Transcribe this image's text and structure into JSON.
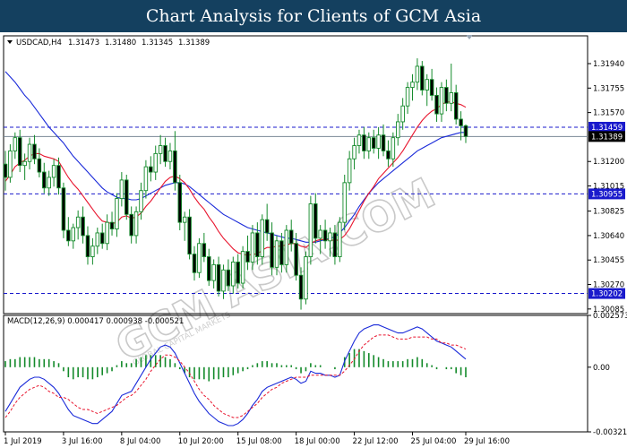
{
  "banner": {
    "title": "Chart Analysis for Clients of GCM Asia"
  },
  "watermark": {
    "text": "GCM ASIA.COM",
    "subtext": "GLOBAL CAPITAL MARKETS"
  },
  "icons": {
    "collapse": "triangle-down-icon",
    "scroll_marker": "triangle-down-icon"
  },
  "chart_data": [
    {
      "type": "candlestick",
      "symbol": "USDCAD,H4",
      "ohlc_header": {
        "open": "1.31473",
        "high": "1.31480",
        "low": "1.31345",
        "close": "1.31389"
      },
      "ylim": [
        1.3005,
        1.3215
      ],
      "yticks": [
        "1.31940",
        "1.31755",
        "1.31570",
        "1.31200",
        "1.31015",
        "1.30825",
        "1.30640",
        "1.30455",
        "1.30270",
        "1.30085"
      ],
      "xticks": [
        "1 Jul 2019",
        "3 Jul 16:00",
        "8 Jul 04:00",
        "10 Jul 20:00",
        "15 Jul 08:00",
        "18 Jul 00:00",
        "22 Jul 12:00",
        "25 Jul 04:00",
        "29 Jul 16:00"
      ],
      "levels": [
        {
          "value": 1.31459,
          "label": "1.31459",
          "color": "#1a1acc"
        },
        {
          "value": 1.31389,
          "label": "1.31389",
          "color": "#000000"
        },
        {
          "value": 1.30955,
          "label": "1.30955",
          "color": "#1a1acc"
        },
        {
          "value": 1.30202,
          "label": "1.30202",
          "color": "#1a1acc"
        }
      ],
      "colors": {
        "candle": "#138a2a",
        "fast_ma": "#e8142d",
        "slow_ma": "#1a2ad9",
        "level": "#1a1acc"
      },
      "candles": [
        [
          1.3118,
          1.3128,
          1.3098,
          1.3108
        ],
        [
          1.3108,
          1.3133,
          1.3104,
          1.3128
        ],
        [
          1.3128,
          1.3142,
          1.3122,
          1.3138
        ],
        [
          1.3138,
          1.3144,
          1.3112,
          1.3117
        ],
        [
          1.3117,
          1.3126,
          1.3106,
          1.312
        ],
        [
          1.312,
          1.3138,
          1.3114,
          1.3133
        ],
        [
          1.3133,
          1.314,
          1.3118,
          1.3122
        ],
        [
          1.3122,
          1.313,
          1.3108,
          1.3112
        ],
        [
          1.3112,
          1.3119,
          1.3096,
          1.31
        ],
        [
          1.31,
          1.3113,
          1.3094,
          1.3108
        ],
        [
          1.3108,
          1.3122,
          1.3101,
          1.3117
        ],
        [
          1.3117,
          1.3123,
          1.3095,
          1.31
        ],
        [
          1.31,
          1.3104,
          1.3062,
          1.3068
        ],
        [
          1.3068,
          1.3078,
          1.3056,
          1.306
        ],
        [
          1.306,
          1.3073,
          1.3054,
          1.307
        ],
        [
          1.307,
          1.3083,
          1.3061,
          1.3078
        ],
        [
          1.3078,
          1.3086,
          1.3058,
          1.3064
        ],
        [
          1.3064,
          1.3071,
          1.3042,
          1.3048
        ],
        [
          1.3048,
          1.3062,
          1.3042,
          1.3056
        ],
        [
          1.3056,
          1.307,
          1.305,
          1.3066
        ],
        [
          1.3066,
          1.3073,
          1.3054,
          1.3058
        ],
        [
          1.3058,
          1.308,
          1.3053,
          1.3074
        ],
        [
          1.3074,
          1.3082,
          1.3064,
          1.3069
        ],
        [
          1.3069,
          1.3096,
          1.3063,
          1.3092
        ],
        [
          1.3092,
          1.3112,
          1.3086,
          1.3106
        ],
        [
          1.3106,
          1.311,
          1.3076,
          1.308
        ],
        [
          1.308,
          1.3086,
          1.3058,
          1.3064
        ],
        [
          1.3064,
          1.3086,
          1.3058,
          1.3082
        ],
        [
          1.3082,
          1.3104,
          1.3076,
          1.3098
        ],
        [
          1.3098,
          1.3121,
          1.3092,
          1.3116
        ],
        [
          1.3116,
          1.3124,
          1.3105,
          1.3112
        ],
        [
          1.3112,
          1.3132,
          1.3106,
          1.3126
        ],
        [
          1.3126,
          1.314,
          1.3118,
          1.3132
        ],
        [
          1.3132,
          1.3138,
          1.3116,
          1.312
        ],
        [
          1.312,
          1.3134,
          1.3114,
          1.3128
        ],
        [
          1.3128,
          1.3143,
          1.3098,
          1.3104
        ],
        [
          1.3104,
          1.311,
          1.3068,
          1.3074
        ],
        [
          1.3074,
          1.3082,
          1.306,
          1.3078
        ],
        [
          1.3078,
          1.3084,
          1.3046,
          1.305
        ],
        [
          1.305,
          1.3056,
          1.303,
          1.3036
        ],
        [
          1.3036,
          1.3062,
          1.3032,
          1.3058
        ],
        [
          1.3058,
          1.3066,
          1.3044,
          1.3048
        ],
        [
          1.3048,
          1.3054,
          1.3026,
          1.303
        ],
        [
          1.303,
          1.3046,
          1.3024,
          1.3042
        ],
        [
          1.3042,
          1.3048,
          1.3018,
          1.3022
        ],
        [
          1.3022,
          1.3042,
          1.3016,
          1.3038
        ],
        [
          1.3038,
          1.3046,
          1.3022,
          1.3026
        ],
        [
          1.3026,
          1.3048,
          1.302,
          1.3044
        ],
        [
          1.3044,
          1.305,
          1.3024,
          1.3028
        ],
        [
          1.3028,
          1.3056,
          1.3024,
          1.3052
        ],
        [
          1.3052,
          1.3064,
          1.3038,
          1.3044
        ],
        [
          1.3044,
          1.3072,
          1.3038,
          1.3066
        ],
        [
          1.3066,
          1.3074,
          1.3042,
          1.3048
        ],
        [
          1.3048,
          1.308,
          1.3042,
          1.3076
        ],
        [
          1.3076,
          1.3088,
          1.306,
          1.3066
        ],
        [
          1.3066,
          1.3074,
          1.3034,
          1.304
        ],
        [
          1.304,
          1.3064,
          1.3034,
          1.306
        ],
        [
          1.306,
          1.3066,
          1.3036,
          1.3042
        ],
        [
          1.3042,
          1.3072,
          1.3036,
          1.3068
        ],
        [
          1.3068,
          1.3076,
          1.3052,
          1.3058
        ],
        [
          1.3058,
          1.3066,
          1.303,
          1.3034
        ],
        [
          1.3034,
          1.304,
          1.3008,
          1.3016
        ],
        [
          1.3016,
          1.3052,
          1.3012,
          1.3048
        ],
        [
          1.3048,
          1.3094,
          1.3042,
          1.3088
        ],
        [
          1.3088,
          1.3096,
          1.3058,
          1.3062
        ],
        [
          1.3062,
          1.3072,
          1.305,
          1.3068
        ],
        [
          1.3068,
          1.3076,
          1.3054,
          1.306
        ],
        [
          1.306,
          1.307,
          1.3048,
          1.3066
        ],
        [
          1.3066,
          1.3072,
          1.3042,
          1.3048
        ],
        [
          1.3048,
          1.3078,
          1.3044,
          1.3074
        ],
        [
          1.3074,
          1.311,
          1.3068,
          1.3104
        ],
        [
          1.3104,
          1.3128,
          1.3098,
          1.3122
        ],
        [
          1.3122,
          1.3138,
          1.3114,
          1.3132
        ],
        [
          1.3132,
          1.3144,
          1.3126,
          1.314
        ],
        [
          1.314,
          1.3146,
          1.3122,
          1.3128
        ],
        [
          1.3128,
          1.3142,
          1.3122,
          1.3138
        ],
        [
          1.3138,
          1.3144,
          1.3126,
          1.313
        ],
        [
          1.313,
          1.3146,
          1.3122,
          1.314
        ],
        [
          1.314,
          1.3148,
          1.3124,
          1.3128
        ],
        [
          1.3128,
          1.3136,
          1.3116,
          1.3122
        ],
        [
          1.3122,
          1.3142,
          1.3116,
          1.3138
        ],
        [
          1.3138,
          1.3156,
          1.3132,
          1.315
        ],
        [
          1.315,
          1.3168,
          1.3144,
          1.3162
        ],
        [
          1.3162,
          1.318,
          1.3156,
          1.3176
        ],
        [
          1.3176,
          1.3186,
          1.3166,
          1.318
        ],
        [
          1.318,
          1.3198,
          1.3174,
          1.3192
        ],
        [
          1.3192,
          1.3196,
          1.317,
          1.3174
        ],
        [
          1.3174,
          1.3186,
          1.3162,
          1.3182
        ],
        [
          1.3182,
          1.319,
          1.3166,
          1.317
        ],
        [
          1.317,
          1.3176,
          1.315,
          1.3156
        ],
        [
          1.3156,
          1.318,
          1.315,
          1.3176
        ],
        [
          1.3176,
          1.3182,
          1.3158,
          1.3164
        ],
        [
          1.3164,
          1.3194,
          1.3158,
          1.3172
        ],
        [
          1.3172,
          1.3178,
          1.3148,
          1.3152
        ],
        [
          1.3152,
          1.3158,
          1.3136,
          1.3147
        ],
        [
          1.3147,
          1.3148,
          1.3134,
          1.3139
        ]
      ],
      "ma_fast": [
        1.3105,
        1.311,
        1.3116,
        1.3119,
        1.3121,
        1.3124,
        1.3126,
        1.3126,
        1.3124,
        1.3123,
        1.3122,
        1.312,
        1.3114,
        1.3108,
        1.3103,
        1.3099,
        1.3094,
        1.3089,
        1.3084,
        1.3079,
        1.3075,
        1.3074,
        1.3073,
        1.3074,
        1.3078,
        1.3079,
        1.3077,
        1.3078,
        1.3081,
        1.3086,
        1.309,
        1.3095,
        1.31,
        1.3105,
        1.3108,
        1.3109,
        1.3107,
        1.3104,
        1.3099,
        1.3093,
        1.3088,
        1.3084,
        1.3078,
        1.3073,
        1.3067,
        1.3062,
        1.3058,
        1.3054,
        1.3051,
        1.305,
        1.3049,
        1.305,
        1.305,
        1.3053,
        1.3055,
        1.3055,
        1.3056,
        1.3056,
        1.3057,
        1.3058,
        1.3058,
        1.3056,
        1.3055,
        1.3058,
        1.306,
        1.3061,
        1.3061,
        1.3061,
        1.306,
        1.3061,
        1.3064,
        1.3069,
        1.3076,
        1.3083,
        1.309,
        1.3096,
        1.3101,
        1.3107,
        1.3111,
        1.3115,
        1.3119,
        1.3123,
        1.3128,
        1.3134,
        1.314,
        1.3146,
        1.3151,
        1.3155,
        1.3158,
        1.316,
        1.3163,
        1.3165,
        1.3165,
        1.3164,
        1.3163,
        1.3161
      ],
      "ma_slow": [
        1.3188,
        1.3184,
        1.318,
        1.3175,
        1.317,
        1.3166,
        1.3161,
        1.3156,
        1.3151,
        1.3146,
        1.3142,
        1.3138,
        1.3134,
        1.3129,
        1.3124,
        1.312,
        1.3116,
        1.3112,
        1.3108,
        1.3104,
        1.31,
        1.3097,
        1.3095,
        1.3093,
        1.3092,
        1.3092,
        1.3091,
        1.3091,
        1.3092,
        1.3094,
        1.3096,
        1.3098,
        1.31,
        1.3102,
        1.3103,
        1.3104,
        1.3104,
        1.3103,
        1.3101,
        1.3098,
        1.3095,
        1.3092,
        1.3089,
        1.3086,
        1.3083,
        1.308,
        1.3078,
        1.3076,
        1.3074,
        1.3072,
        1.307,
        1.3069,
        1.3068,
        1.3067,
        1.3066,
        1.3065,
        1.3064,
        1.3063,
        1.3062,
        1.3062,
        1.3061,
        1.306,
        1.3059,
        1.3059,
        1.3059,
        1.306,
        1.3061,
        1.3062,
        1.3063,
        1.3066,
        1.307,
        1.3075,
        1.308,
        1.3086,
        1.3091,
        1.3096,
        1.31,
        1.3104,
        1.3107,
        1.311,
        1.3113,
        1.3116,
        1.3119,
        1.3122,
        1.3125,
        1.3128,
        1.313,
        1.3132,
        1.3134,
        1.3136,
        1.3138,
        1.3139,
        1.314,
        1.3141,
        1.3142,
        1.3142
      ]
    },
    {
      "type": "macd",
      "label": "MACD(12,26,9) 0.000417 0.000938 -0.000521",
      "yticks": [
        "0.002573",
        "0.00",
        "-0.003213"
      ],
      "ylim": [
        -0.003213,
        0.002573
      ],
      "colors": {
        "hist": "#138a2a",
        "macd": "#1a2ad9",
        "signal": "#e8142d"
      },
      "hist": [
        0.0003,
        0.0004,
        0.0004,
        0.0005,
        0.0005,
        0.0005,
        0.0005,
        0.0004,
        0.0004,
        0.0004,
        0.0003,
        0.0002,
        -0.0002,
        -0.0005,
        -0.0006,
        -0.0005,
        -0.0005,
        -0.0006,
        -0.0006,
        -0.0005,
        -0.0004,
        -0.0003,
        -0.0002,
        0.0001,
        0.0003,
        0.0002,
        0.0002,
        0.0004,
        0.0005,
        0.0006,
        0.0006,
        0.0006,
        0.0006,
        0.0005,
        0.0004,
        0.0002,
        -0.0001,
        -0.0003,
        -0.0005,
        -0.0006,
        -0.0006,
        -0.0006,
        -0.0007,
        -0.0006,
        -0.0006,
        -0.0005,
        -0.0005,
        -0.0004,
        -0.0003,
        -0.0002,
        -0.0001,
        0.0001,
        0.0002,
        0.0003,
        0.0003,
        0.0002,
        0.0002,
        0.0001,
        0.0001,
        0.0001,
        -0.0001,
        -0.0003,
        -0.0002,
        0.0002,
        0.0001,
        0.0001,
        0.0,
        0.0,
        -0.0001,
        0.0,
        0.0005,
        0.0007,
        0.0009,
        0.0009,
        0.0008,
        0.0007,
        0.0006,
        0.0005,
        0.0004,
        0.0003,
        0.0003,
        0.0003,
        0.0003,
        0.0004,
        0.0004,
        0.0005,
        0.0004,
        0.0002,
        0.0001,
        -0.0001,
        0.0,
        -0.0001,
        -0.0001,
        -0.0003,
        -0.0004,
        -0.0005
      ],
      "macd": [
        -0.0022,
        -0.0018,
        -0.0014,
        -0.001,
        -0.0008,
        -0.0006,
        -0.0005,
        -0.0005,
        -0.0006,
        -0.0008,
        -0.001,
        -0.0013,
        -0.0017,
        -0.0021,
        -0.0024,
        -0.0025,
        -0.0026,
        -0.0027,
        -0.0028,
        -0.0028,
        -0.0026,
        -0.0024,
        -0.0022,
        -0.0018,
        -0.0014,
        -0.0013,
        -0.0012,
        -0.0008,
        -0.0004,
        0.0,
        0.0004,
        0.0007,
        0.001,
        0.0011,
        0.001,
        0.0007,
        0.0002,
        -0.0003,
        -0.0008,
        -0.0013,
        -0.0017,
        -0.002,
        -0.0023,
        -0.0025,
        -0.0027,
        -0.0028,
        -0.0029,
        -0.0029,
        -0.0028,
        -0.0026,
        -0.0023,
        -0.0019,
        -0.0016,
        -0.0012,
        -0.001,
        -0.0009,
        -0.0008,
        -0.0007,
        -0.0006,
        -0.0005,
        -0.0006,
        -0.0008,
        -0.0007,
        -0.0002,
        -0.0003,
        -0.0003,
        -0.0004,
        -0.0004,
        -0.0005,
        -0.0004,
        0.0003,
        0.0008,
        0.0013,
        0.0017,
        0.0019,
        0.002,
        0.0021,
        0.0021,
        0.002,
        0.0019,
        0.0018,
        0.0017,
        0.0017,
        0.0018,
        0.0019,
        0.002,
        0.0019,
        0.0017,
        0.0015,
        0.0013,
        0.0012,
        0.0011,
        0.001,
        0.0008,
        0.0006,
        0.0004
      ],
      "signal": [
        -0.0025,
        -0.0022,
        -0.0018,
        -0.0015,
        -0.0013,
        -0.0011,
        -0.001,
        -0.0009,
        -0.001,
        -0.0012,
        -0.0013,
        -0.0015,
        -0.0015,
        -0.0016,
        -0.0018,
        -0.002,
        -0.0021,
        -0.0021,
        -0.0022,
        -0.0023,
        -0.0022,
        -0.0021,
        -0.002,
        -0.0019,
        -0.0017,
        -0.0015,
        -0.0014,
        -0.0012,
        -0.0009,
        -0.0006,
        -0.0002,
        0.0001,
        0.0004,
        0.0006,
        0.0006,
        0.0005,
        0.0003,
        0.0,
        -0.0003,
        -0.0007,
        -0.0011,
        -0.0014,
        -0.0016,
        -0.0019,
        -0.0021,
        -0.0023,
        -0.0024,
        -0.0025,
        -0.0025,
        -0.0024,
        -0.0022,
        -0.002,
        -0.0018,
        -0.0015,
        -0.0013,
        -0.0011,
        -0.001,
        -0.0008,
        -0.0007,
        -0.0006,
        -0.0005,
        -0.0005,
        -0.0005,
        -0.0004,
        -0.0004,
        -0.0004,
        -0.0004,
        -0.0004,
        -0.0004,
        -0.0004,
        -0.0002,
        0.0001,
        0.0004,
        0.0008,
        0.0011,
        0.0013,
        0.0015,
        0.0016,
        0.0016,
        0.0016,
        0.0015,
        0.0014,
        0.0014,
        0.0014,
        0.0015,
        0.0015,
        0.0015,
        0.0015,
        0.0014,
        0.0014,
        0.0012,
        0.0012,
        0.0011,
        0.0011,
        0.001,
        0.0009
      ]
    }
  ]
}
